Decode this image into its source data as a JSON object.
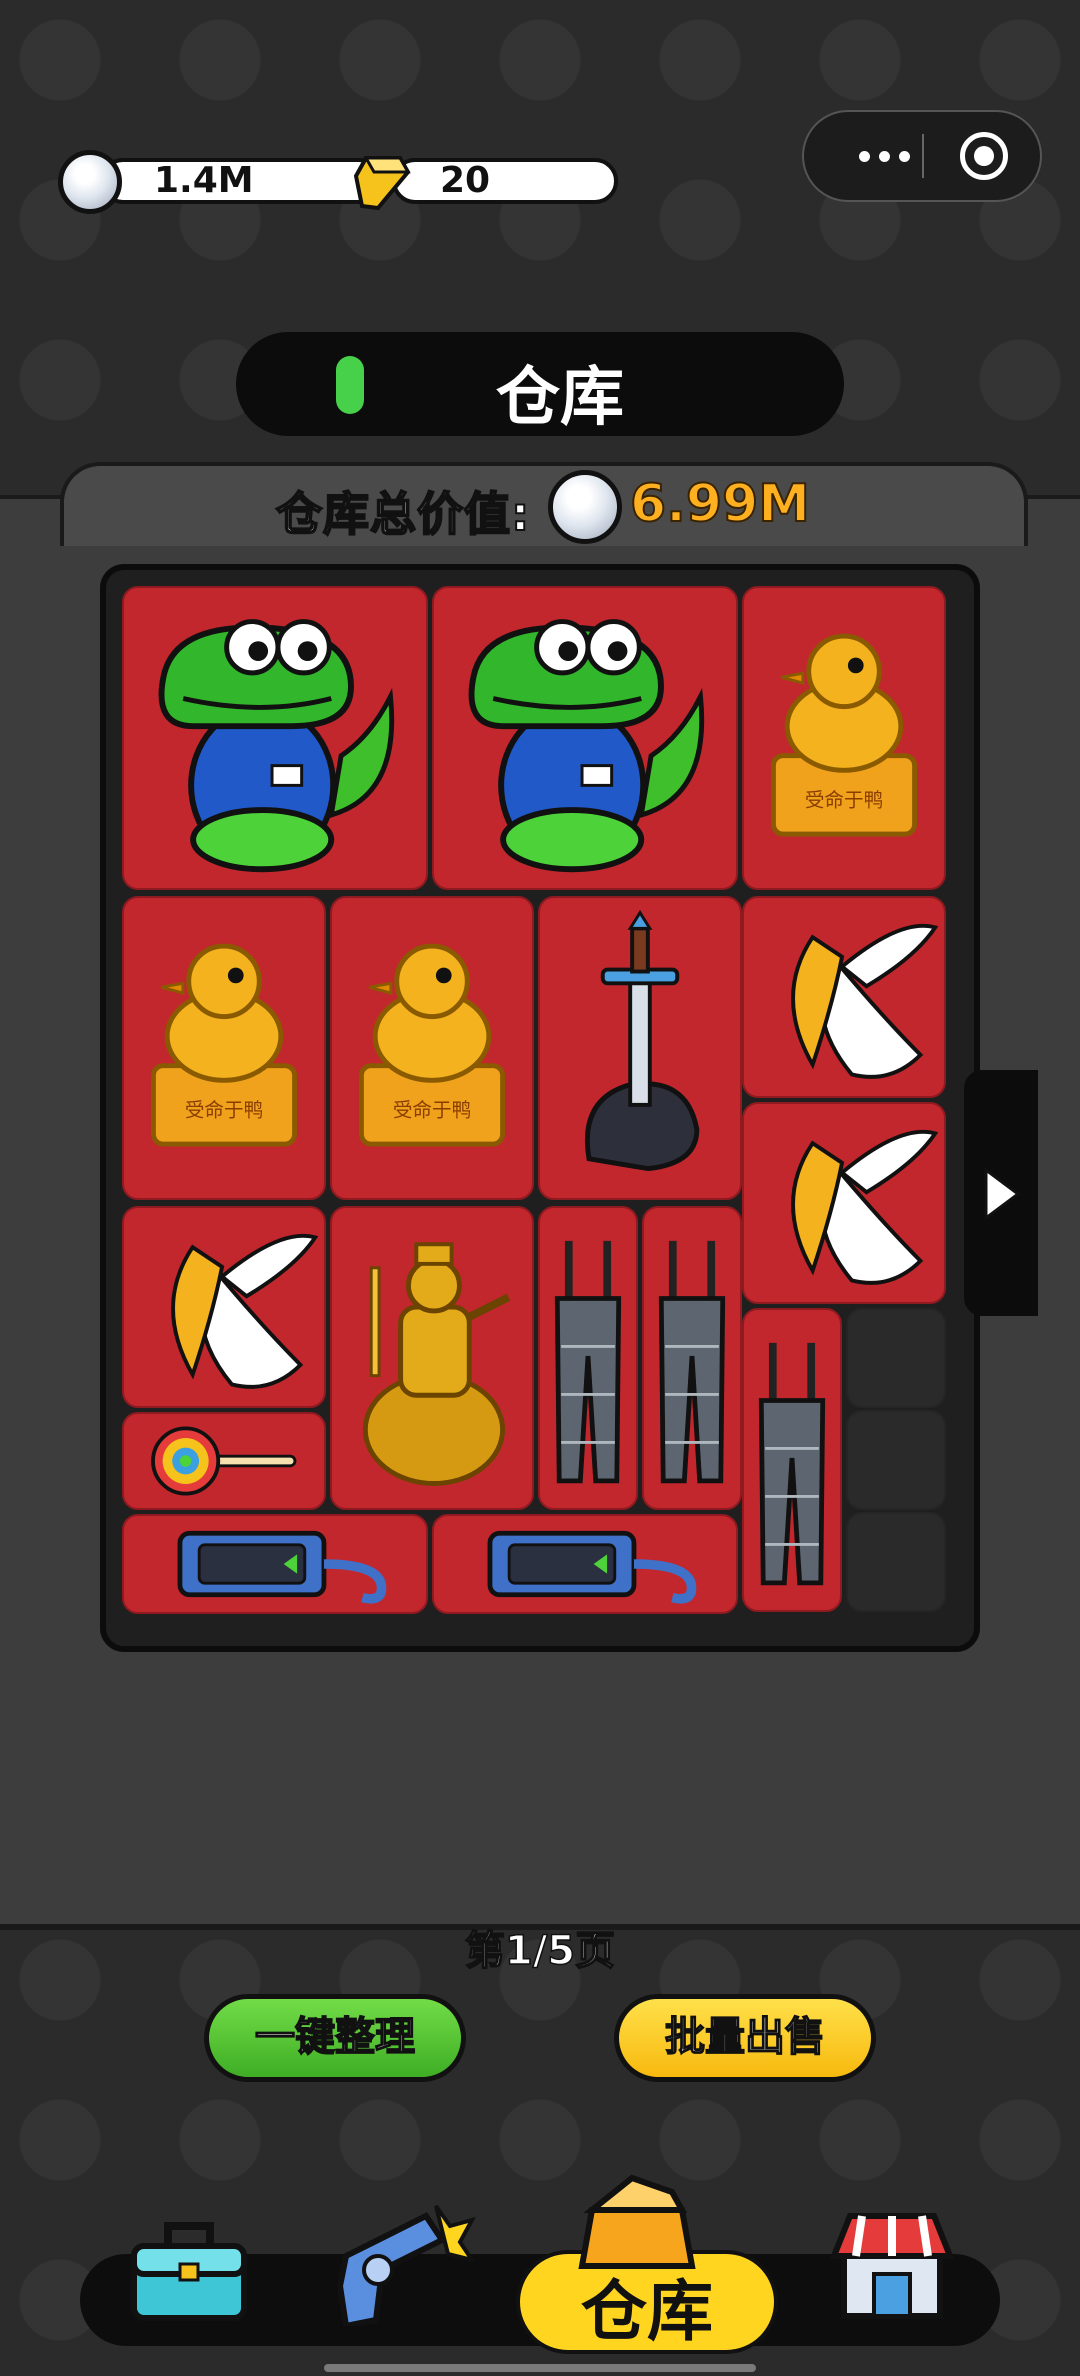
{
  "currency": {
    "silver_value": "1.4M",
    "gold_value": "20"
  },
  "icons": {
    "silver": "silver-coin-icon",
    "gold": "gold-bar-icon",
    "more": "more-dots-icon",
    "close": "target-close-icon",
    "next": "chevron-right-icon"
  },
  "title": {
    "text": "仓库"
  },
  "warehouse": {
    "total_label": "仓库总价值:",
    "total_value": "6.99M"
  },
  "grid": {
    "items": [
      {
        "name": "crocodile-mascot",
        "label": ""
      },
      {
        "name": "crocodile-mascot",
        "label": ""
      },
      {
        "name": "golden-duck-seal",
        "label": "受命于鸭"
      },
      {
        "name": "golden-duck-seal",
        "label": "受命于鸭"
      },
      {
        "name": "golden-duck-seal",
        "label": "受命于鸭"
      },
      {
        "name": "sword-in-stone",
        "label": ""
      },
      {
        "name": "winged-relic",
        "label": ""
      },
      {
        "name": "winged-relic",
        "label": ""
      },
      {
        "name": "winged-relic",
        "label": ""
      },
      {
        "name": "golden-emperor-on-bear",
        "label": ""
      },
      {
        "name": "suspender-trousers",
        "label": ""
      },
      {
        "name": "suspender-trousers",
        "label": ""
      },
      {
        "name": "suspender-trousers",
        "label": ""
      },
      {
        "name": "target-lollipop",
        "label": ""
      },
      {
        "name": "handheld-device",
        "label": ""
      },
      {
        "name": "handheld-device",
        "label": ""
      }
    ]
  },
  "pagination": {
    "text": "第1/5页"
  },
  "actions": {
    "organize_label": "一键整理",
    "bulk_sell_label": "批量出售"
  },
  "nav": {
    "active_label": "仓库",
    "items": [
      "toolbox-icon",
      "revolver-icon",
      "warehouse-box-icon",
      "shop-icon"
    ]
  },
  "colors": {
    "cell_red": "#c1272d",
    "accent_yellow": "#ffd51f",
    "accent_green": "#47d14a",
    "value_orange": "#ffb020"
  }
}
